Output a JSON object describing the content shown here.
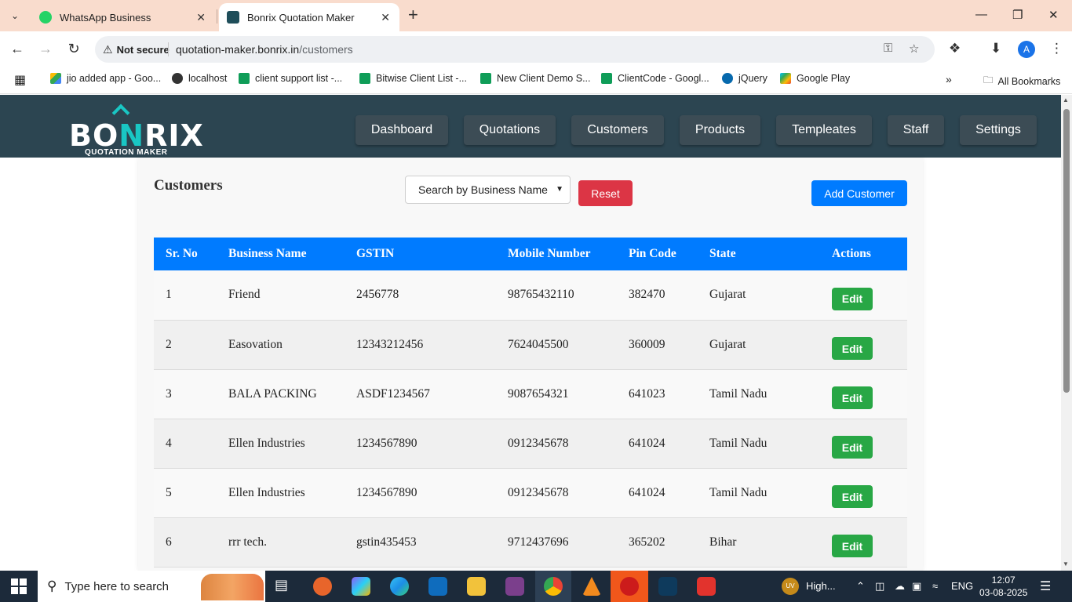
{
  "browser": {
    "tabs": [
      {
        "title": "WhatsApp Business"
      },
      {
        "title": "Bonrix Quotation Maker"
      }
    ],
    "address": {
      "security_label": "Not secure",
      "url_host": "quotation-maker.bonrix.in",
      "url_path": "/customers"
    },
    "profile_initial": "A",
    "bookmarks": [
      "jio added app - Goo...",
      "localhost",
      "client support list -...",
      "Bitwise Client List -...",
      "New Client Demo S...",
      "ClientCode - Googl...",
      "jQuery",
      "Google Play"
    ],
    "all_bookmarks": "All Bookmarks"
  },
  "app": {
    "logo_word_a": "BO",
    "logo_word_b": "N",
    "logo_word_c": "RIX",
    "logo_sub": "QUOTATION MAKER",
    "nav": [
      "Dashboard",
      "Quotations",
      "Customers",
      "Products",
      "Templeates",
      "Staff",
      "Settings"
    ]
  },
  "page": {
    "title": "Customers",
    "search_select": "Search by Business Name",
    "reset_label": "Reset",
    "add_label": "Add Customer",
    "edit_label": "Edit",
    "columns": [
      "Sr. No",
      "Business Name",
      "GSTIN",
      "Mobile Number",
      "Pin Code",
      "State",
      "Actions"
    ],
    "rows": [
      [
        "1",
        "Friend",
        "2456778",
        "98765432110",
        "382470",
        "Gujarat"
      ],
      [
        "2",
        "Easovation",
        "12343212456",
        "7624045500",
        "360009",
        "Gujarat"
      ],
      [
        "3",
        "BALA PACKING",
        "ASDF1234567",
        "9087654321",
        "641023",
        "Tamil Nadu"
      ],
      [
        "4",
        "Ellen Industries",
        "1234567890",
        "0912345678",
        "641024",
        "Tamil Nadu"
      ],
      [
        "5",
        "Ellen Industries",
        "1234567890",
        "0912345678",
        "641024",
        "Tamil Nadu"
      ],
      [
        "6",
        "rrr tech.",
        "gstin435453",
        "9712437696",
        "365202",
        "Bihar"
      ]
    ]
  },
  "taskbar": {
    "search_placeholder": "Type here to search",
    "weather_badge": "UV",
    "weather_text": "High...",
    "lang": "ENG",
    "time": "12:07",
    "date": "03-08-2025"
  }
}
